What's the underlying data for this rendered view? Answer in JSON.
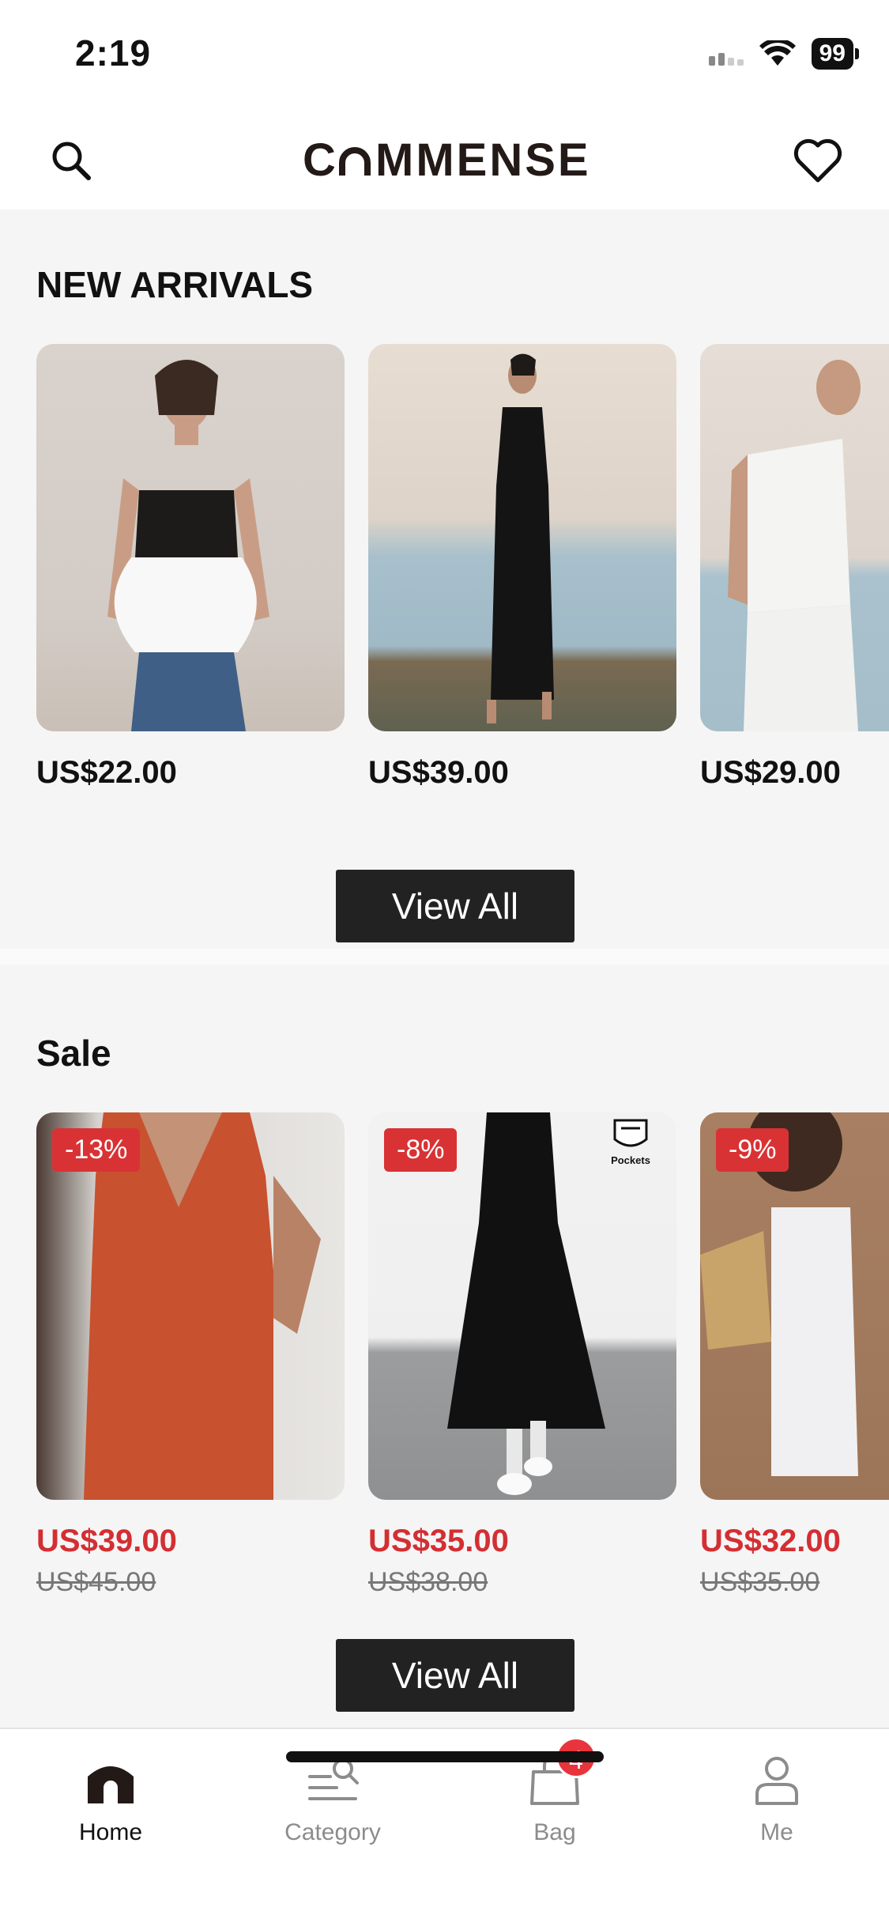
{
  "status": {
    "time": "2:19",
    "battery": "99"
  },
  "header": {
    "logo": "CꟷMMENSE",
    "search_icon": "search-icon",
    "wishlist_icon": "heart-icon"
  },
  "new_arrivals": {
    "title": "NEW ARRIVALS",
    "items": [
      {
        "price": "US$22.00",
        "image": "strapless-peplum-top"
      },
      {
        "price": "US$39.00",
        "image": "black-knit-maxi-dress"
      },
      {
        "price": "US$29.00",
        "image": "white-tie-front-top"
      }
    ],
    "view_all": "View All"
  },
  "sale": {
    "title": "Sale",
    "items": [
      {
        "badge": "-13%",
        "price": "US$39.00",
        "old_price": "US$45.00",
        "image": "orange-linen-dress"
      },
      {
        "badge": "-8%",
        "price": "US$35.00",
        "old_price": "US$38.00",
        "image": "black-maxi-dress",
        "tag": "Pockets"
      },
      {
        "badge": "-9%",
        "price": "US$32.00",
        "old_price": "US$35.00",
        "image": "white-mini-dress"
      }
    ],
    "view_all": "View All"
  },
  "tabs": [
    {
      "label": "Home",
      "icon": "home-icon",
      "active": true
    },
    {
      "label": "Category",
      "icon": "category-icon",
      "active": false
    },
    {
      "label": "Bag",
      "icon": "bag-icon",
      "active": false,
      "badge": "4"
    },
    {
      "label": "Me",
      "icon": "person-icon",
      "active": false
    }
  ],
  "colors": {
    "sale_red": "#d32f33",
    "badge_red": "#d93234",
    "button_dark": "#222222",
    "background": "#f6f5f5"
  }
}
